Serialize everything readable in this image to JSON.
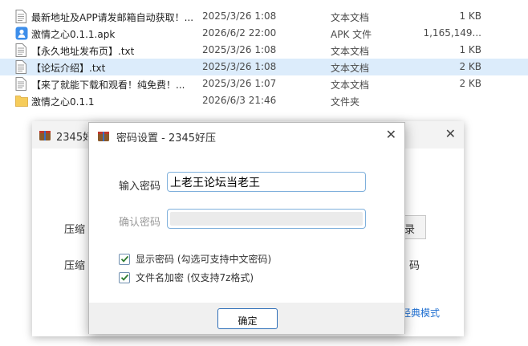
{
  "files": [
    {
      "name": "最新地址及APP请发邮箱自动获取！...",
      "date": "2025/3/26 1:08",
      "type": "文本文档",
      "size": "1 KB",
      "icon": "text-file-icon"
    },
    {
      "name": "激情之心0.1.1.apk",
      "date": "2026/6/2 22:00",
      "type": "APK 文件",
      "size": "1,165,149...",
      "icon": "apk-file-icon"
    },
    {
      "name": "【永久地址发布页】.txt",
      "date": "2025/3/26 1:08",
      "type": "文本文档",
      "size": "1 KB",
      "icon": "text-file-icon"
    },
    {
      "name": "【论坛介绍】.txt",
      "date": "2025/3/26 1:08",
      "type": "文本文档",
      "size": "2 KB",
      "icon": "text-file-icon",
      "selected": true
    },
    {
      "name": "【来了就能下载和观看！纯免费！...",
      "date": "2025/3/26 1:07",
      "type": "文本文档",
      "size": "2 KB",
      "icon": "text-file-icon"
    },
    {
      "name": "激情之心0.1.1",
      "date": "2026/6/3 21:46",
      "type": "文件夹",
      "size": "",
      "icon": "folder-icon"
    }
  ],
  "bg_window": {
    "title": "2345好",
    "label_1": "压缩",
    "label_2": "压缩",
    "button_partial": "录",
    "right_text": "码",
    "link": "经典模式"
  },
  "dialog": {
    "title": "密码设置 - 2345好压",
    "password_label": "输入密码",
    "password_value": "上老王论坛当老王",
    "confirm_label": "确认密码",
    "confirm_value": "",
    "show_password_label": "显示密码 (勾选可支持中文密码)",
    "show_password_checked": true,
    "encrypt_names_label": "文件名加密 (仅支持7z格式)",
    "encrypt_names_checked": true,
    "ok_label": "确定"
  },
  "colors": {
    "selection": "#dcecfb",
    "accent": "#2f6fb8",
    "link": "#1f6fd1"
  }
}
